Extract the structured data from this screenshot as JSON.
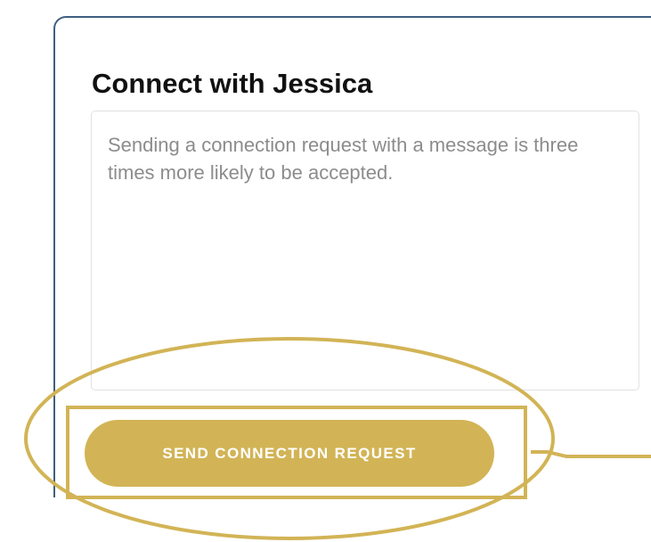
{
  "dialog": {
    "title": "Connect with Jessica",
    "message_placeholder": "Sending a connection request with a message is three times more likely to be accepted.",
    "message_value": "",
    "send_label": "SEND CONNECTION REQUEST"
  },
  "colors": {
    "accent_gold": "#d2b456",
    "card_border": "#3e5f7f",
    "placeholder_text": "#8c8c8c"
  }
}
